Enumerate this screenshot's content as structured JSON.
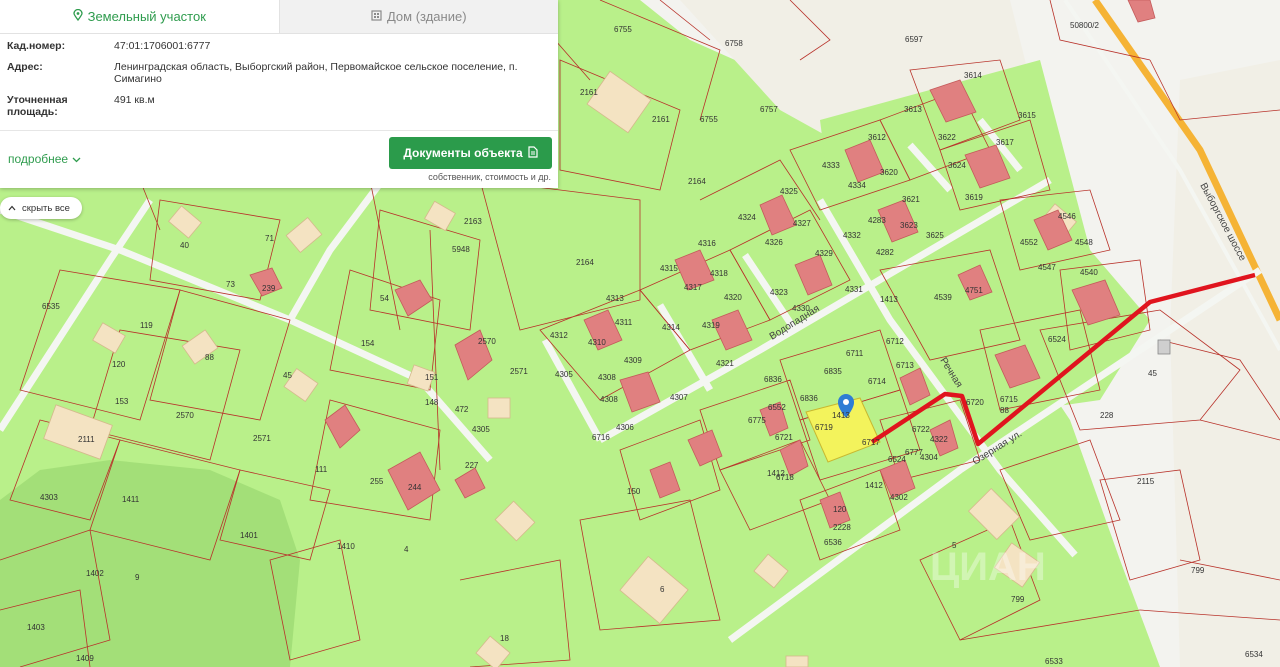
{
  "colors": {
    "map_green": "#b9f08a",
    "road_white": "#f4f6f2",
    "house_pink": "#e08080",
    "highlight_yellow": "#f3f35c",
    "route_red": "#e0141e",
    "highway_orange": "#f5b335",
    "accent_green": "#2b9b4b"
  },
  "card": {
    "tab_land": "Земельный участок",
    "tab_house": "Дом (здание)",
    "fields": [
      {
        "key": "Кад.номер:",
        "value": "47:01:1706001:6777"
      },
      {
        "key": "Адрес:",
        "value": "Ленинградская область, Выборгский район, Первомайское сельское поселение, п. Симагино"
      },
      {
        "key": "Уточненная площадь:",
        "value": "491 кв.м"
      }
    ],
    "more_label": "подробнее",
    "docs_button": "Документы объекта",
    "docs_note": "собственник, стоимость и др."
  },
  "hide_all": "скрыть все",
  "map": {
    "street_vodopadnaya": "Водопадная",
    "street_rechnaya": "Речная",
    "street_ozernaya": "Озерная ул.",
    "highway": "Выборгское шоссе",
    "watermark": "ЦИАН",
    "labels": [
      "6755",
      "6758",
      "6597",
      "50800/2",
      "2161",
      "6757",
      "2161",
      "3614",
      "3613",
      "3612",
      "6755",
      "4333",
      "3622",
      "3617",
      "3615",
      "3624",
      "2164",
      "4334",
      "3620",
      "3619",
      "3621",
      "3623",
      "4325",
      "4324",
      "4326",
      "4327",
      "4283",
      "3625",
      "4332",
      "2163",
      "4282",
      "4546",
      "40",
      "71",
      "4552",
      "4548",
      "5948",
      "4316",
      "2164",
      "4329",
      "4547",
      "4315",
      "4317",
      "4318",
      "73",
      "239",
      "4330",
      "4331",
      "4539",
      "4540",
      "4313",
      "4320",
      "4323",
      "4751",
      "1413",
      "4312",
      "4311",
      "4319",
      "6524",
      "4310",
      "54",
      "154",
      "2570",
      "4305",
      "4309",
      "4308",
      "4314",
      "4321",
      "6711",
      "6712",
      "4308",
      "4307",
      "6836",
      "6835",
      "6713",
      "6714",
      "120",
      "119",
      "88",
      "45",
      "151",
      "2571",
      "6836",
      "6775",
      "6552",
      "4306",
      "4305",
      "6715",
      "6716",
      "6717",
      "6721",
      "1413",
      "6777",
      "6720",
      "6719",
      "6722",
      "6718",
      "6524",
      "1412",
      "1412",
      "120",
      "88",
      "45",
      "228",
      "153",
      "2570",
      "2571",
      "2111",
      "148",
      "472",
      "227",
      "255",
      "244",
      "4303",
      "1411",
      "111",
      "150",
      "2115",
      "1401",
      "1410",
      "4",
      "5",
      "799",
      "1402",
      "9",
      "6",
      "799",
      "1403",
      "1409",
      "18",
      "6533",
      "6534",
      "6535",
      "6536",
      "2228",
      "4302",
      "4304",
      "4322"
    ]
  }
}
